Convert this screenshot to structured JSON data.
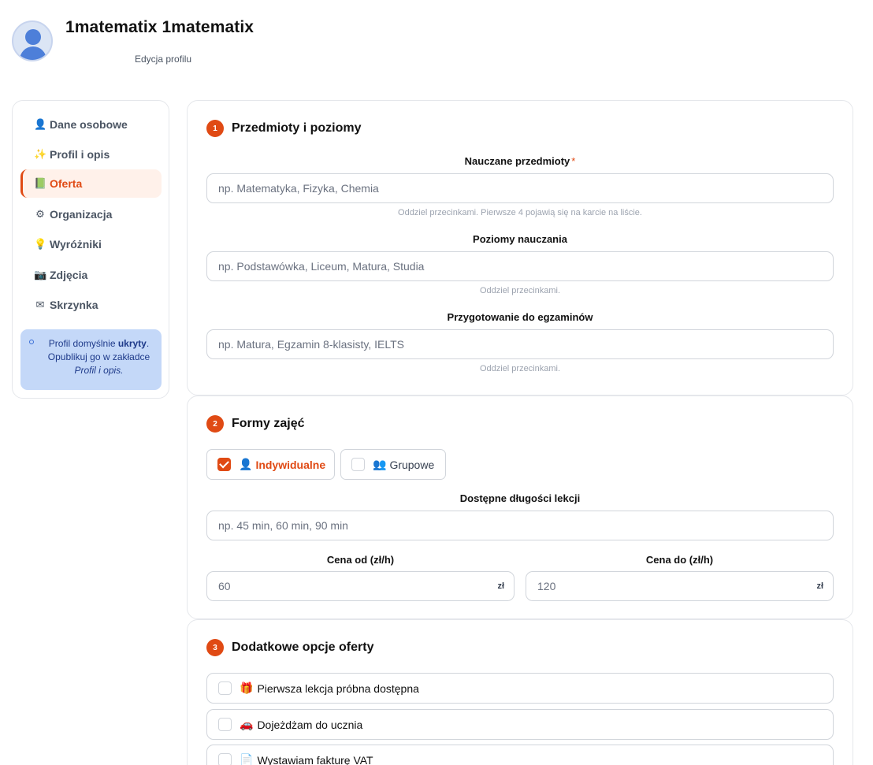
{
  "header": {
    "name": "1matematix 1matematix",
    "subtitle": "Edycja profilu"
  },
  "sidebar": {
    "items": [
      {
        "icon": "👤",
        "label": "Dane osobowe",
        "active": false
      },
      {
        "icon": "✨",
        "label": "Profil i opis",
        "active": false
      },
      {
        "icon": "📗",
        "label": "Oferta",
        "active": true
      },
      {
        "icon": "⚙",
        "label": "Organizacja",
        "active": false
      },
      {
        "icon": "💡",
        "label": "Wyróżniki",
        "active": false
      },
      {
        "icon": "📷",
        "label": "Zdjęcia",
        "active": false
      },
      {
        "icon": "✉",
        "label": "Skrzynka",
        "active": false
      }
    ],
    "notice": {
      "line1_prefix": "Profil domyślnie ",
      "line1_bold": "ukryty",
      "line1_suffix": ".",
      "line2": "Opublikuj go w zakładce",
      "line3": "Profil i opis."
    }
  },
  "section1": {
    "number": "1",
    "title": "Przedmioty i poziomy",
    "subjects_label": "Nauczane przedmioty",
    "subjects_required": "*",
    "subjects_placeholder": "np. Matematyka, Fizyka, Chemia",
    "subjects_hint": "Oddziel przecinkami. Pierwsze 4 pojawią się na karcie na liście.",
    "levels_label": "Poziomy nauczania",
    "levels_placeholder": "np. Podstawówka, Liceum, Matura, Studia",
    "levels_hint": "Oddziel przecinkami.",
    "exams_label": "Przygotowanie do egzaminów",
    "exams_placeholder": "np. Matura, Egzamin 8-klasisty, IELTS",
    "exams_hint": "Oddziel przecinkami."
  },
  "section2": {
    "number": "2",
    "title": "Formy zajęć",
    "forms": [
      {
        "icon": "👤",
        "label": "Indywidualne",
        "checked": true
      },
      {
        "icon": "👥",
        "label": "Grupowe",
        "checked": false
      }
    ],
    "lengths_label": "Dostępne długości lekcji",
    "lengths_placeholder": "np. 45 min, 60 min, 90 min",
    "price_from_label": "Cena od (zł/h)",
    "price_from_value": "60",
    "price_to_label": "Cena do (zł/h)",
    "price_to_value": "120",
    "currency": "zł"
  },
  "section3": {
    "number": "3",
    "title": "Dodatkowe opcje oferty",
    "options": [
      {
        "icon": "🎁",
        "label": "Pierwsza lekcja próbna dostępna",
        "checked": false
      },
      {
        "icon": "🚗",
        "label": "Dojeżdżam do ucznia",
        "checked": false
      },
      {
        "icon": "📄",
        "label": "Wystawiam fakturę VAT",
        "checked": false
      }
    ]
  },
  "colors": {
    "accent": "#e04a14",
    "notice_bg": "#c4d8f8",
    "active_bg": "#fff1ea"
  }
}
